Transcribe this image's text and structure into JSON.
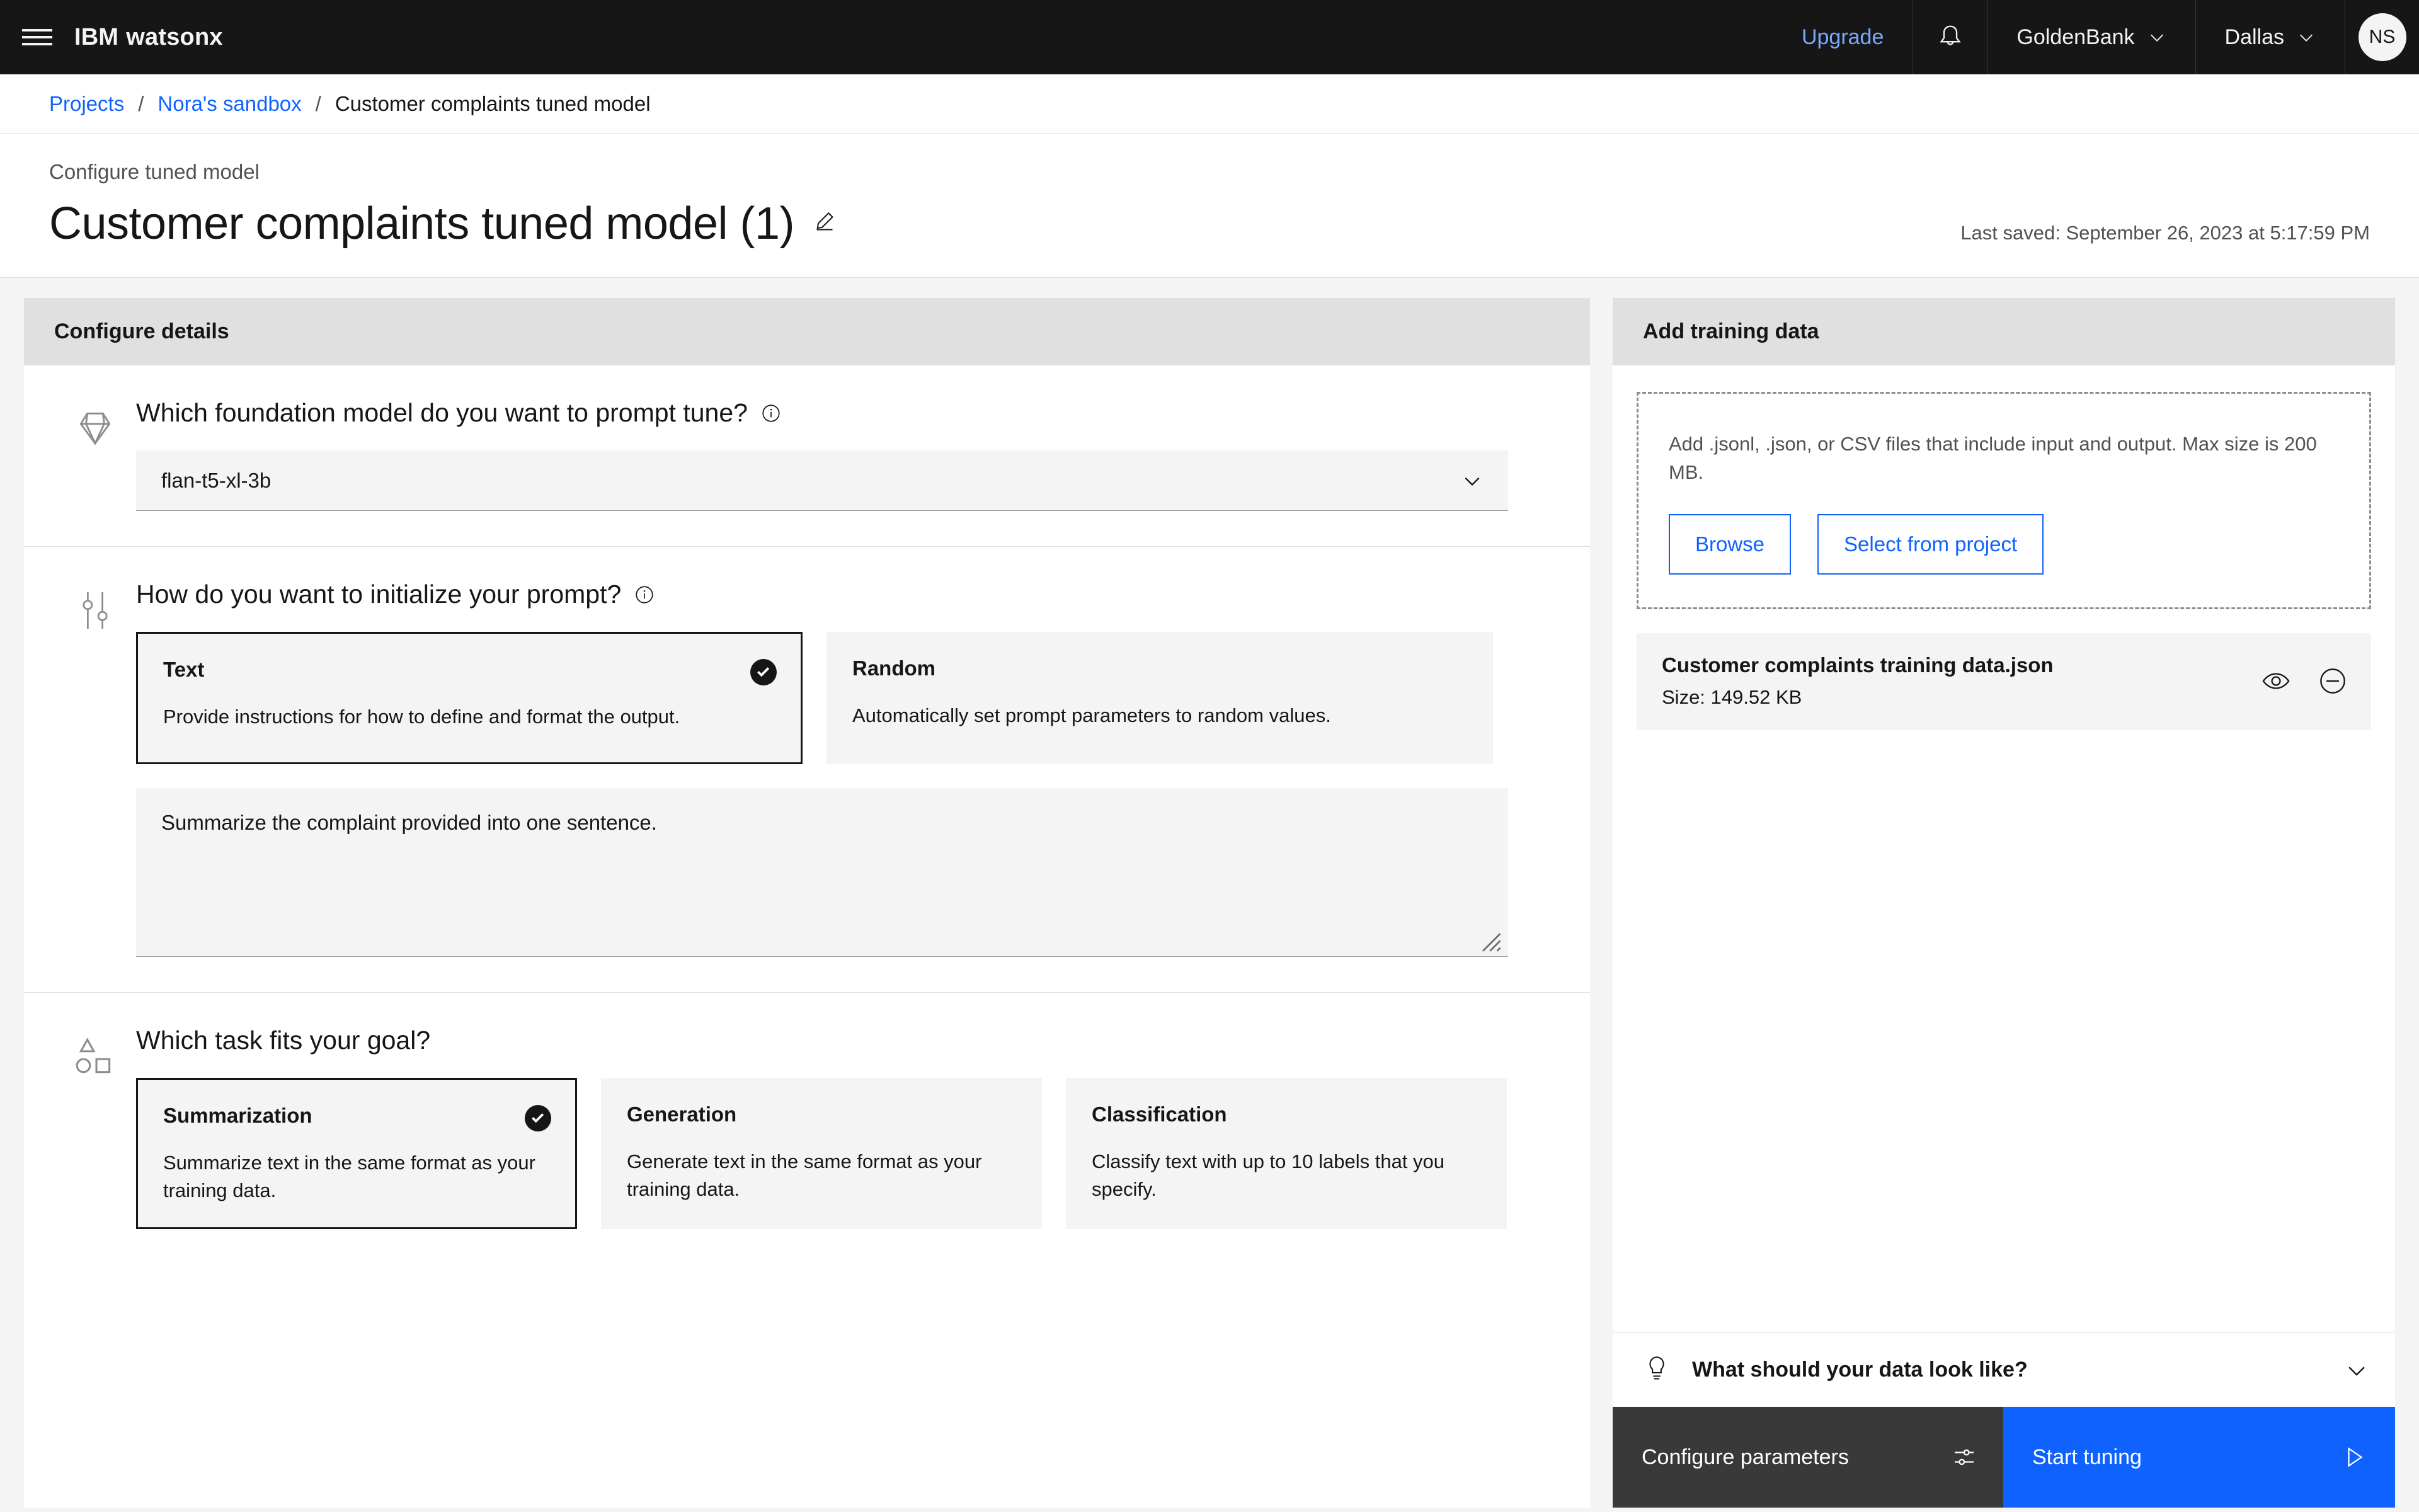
{
  "header": {
    "brand_ibm": "IBM",
    "brand_product": "watsonx",
    "upgrade_label": "Upgrade",
    "account_label": "GoldenBank",
    "region_label": "Dallas",
    "avatar_initials": "NS"
  },
  "breadcrumb": {
    "item1": "Projects",
    "item2": "Nora's sandbox",
    "current": "Customer complaints tuned model",
    "separator": "/"
  },
  "page": {
    "eyebrow": "Configure tuned model",
    "title": "Customer complaints tuned model (1)",
    "last_saved": "Last saved: September 26, 2023 at 5:17:59 PM"
  },
  "configure_details": {
    "panel_title": "Configure details",
    "model_section": {
      "question": "Which foundation model do you want to prompt tune?",
      "selected_model": "flan-t5-xl-3b"
    },
    "init_section": {
      "question": "How do you want to initialize your prompt?",
      "options": [
        {
          "label": "Text",
          "description": "Provide instructions for how to define and format the output.",
          "selected": true
        },
        {
          "label": "Random",
          "description": "Automatically set prompt parameters to random values.",
          "selected": false
        }
      ],
      "prompt_text": "Summarize the complaint provided into one sentence."
    },
    "task_section": {
      "question": "Which task fits your goal?",
      "options": [
        {
          "label": "Summarization",
          "description": "Summarize text in the same format as your training data.",
          "selected": true
        },
        {
          "label": "Generation",
          "description": "Generate text in the same format as your training data.",
          "selected": false
        },
        {
          "label": "Classification",
          "description": "Classify text with up to 10 labels that you specify.",
          "selected": false
        }
      ]
    }
  },
  "training_data": {
    "panel_title": "Add training data",
    "dropzone_text": "Add .jsonl, .json, or CSV files that include input and output. Max size is 200 MB.",
    "browse_label": "Browse",
    "select_project_label": "Select from project",
    "files": [
      {
        "name": "Customer complaints training data.json",
        "size": "Size: 149.52 KB"
      }
    ],
    "accordion_label": "What should your data look like?"
  },
  "actions": {
    "configure_label": "Configure parameters",
    "start_label": "Start tuning"
  },
  "colors": {
    "brand_blue": "#0f62fe",
    "link_blue": "#78a9ff",
    "dark": "#161616",
    "dark_button": "#393939",
    "panel_head": "#e0e0e0",
    "field_bg": "#f4f4f4"
  }
}
